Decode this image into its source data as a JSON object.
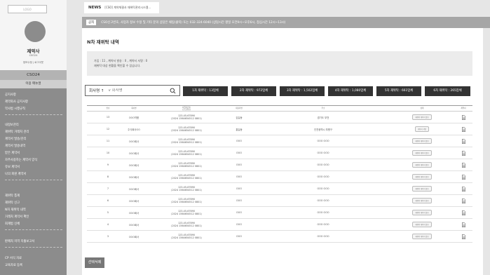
{
  "sidebar": {
    "logo": "LOGO",
    "pharmacy_name": "제약사",
    "pharmacy_code": "CSO24",
    "user_links": "정보수정 | 로그아웃",
    "code_label": "CSO24",
    "guide_label": "이용 매뉴얼",
    "groups": [
      [
        "공지사항",
        "제약회사 공지사항",
        "약사법 시행규칙"
      ],
      [
        "내정보관리",
        "재위탁 거래처 관리",
        "계약서 발송/관리",
        "계약서 발송내역",
        "받은 계약서",
        "자주사용하는 계약서 양식",
        "유보 계약서",
        "나의 회원 계약서"
      ],
      [
        "재위탁 통계",
        "재위탁 신고",
        "N차 재위탁 내역",
        "거래처 계약서 확인",
        "회계법 신체"
      ],
      [
        "판매처 지역 지출보고서"
      ],
      [
        "CP 서식 자료",
        "교육자료 등록"
      ]
    ]
  },
  "topbar": {
    "news_label": "NEWS",
    "news_text": "[CSO] 계약체결사 재위탁관리시스템..."
  },
  "notice": {
    "tag": "공지",
    "text": "CSO신고번호, 사업자 정보 수정 및 기타 문의 상담은 채팅(클릭) 또는 032-324-6040 (상담시간 평일 오전9시~오후6시, 점심시간 12시~13시)"
  },
  "main": {
    "title": "N차 재위탁 내역",
    "summary_line1": "가입 : 11 , 계약서 발송 : 0 , 계약서 서명 : 0",
    "summary_line2": "재위탁 대상 현황을 확인할 수 있습니다.",
    "search_select": "회사명 ↑",
    "search_placeholder": "v 회사명",
    "filters": [
      "1차 재위탁 : 13업체",
      "2차 재위탁 : 972업체",
      "3차 재위탁 : 1,502업체",
      "4차 재위탁 : 1,080업체",
      "5차 재위탁 : 661업체",
      "6차 재위탁 : 265업체"
    ],
    "bulk_delete": "선택삭제"
  },
  "table": {
    "headers": [
      "",
      "번호",
      "회사명",
      "사업자번호\n(신고번호)",
      "대표자명",
      "주소",
      "상태",
      "계약서"
    ],
    "rows": [
      {
        "no": "13",
        "company": "OOO약품",
        "biz": "123-45-67890",
        "reg": "(2024 1564654512 0801)",
        "ceo": "김길동",
        "addr": "경기도 부천",
        "status": "재위탁 계약서 발송"
      },
      {
        "no": "12",
        "company": "주식회사OO",
        "biz": "123-45-67890",
        "reg": "(2024 1564654512 0801)",
        "ceo": "홍길동",
        "addr": "인천광역시 부평구",
        "status": "계약서 서명"
      },
      {
        "no": "11",
        "company": "OOO회사",
        "biz": "123-45-67890",
        "reg": "(2024 1564654512 0801)",
        "ceo": "OOO",
        "addr": "OOO OOO",
        "status": "재위탁 계약서 발송"
      },
      {
        "no": "10",
        "company": "OOO회사",
        "biz": "123-45-67890",
        "reg": "(2024 1564654512 0801)",
        "ceo": "OOO",
        "addr": "OOO OOO",
        "status": "재위탁 계약서 발송"
      },
      {
        "no": "9",
        "company": "OOO회사",
        "biz": "123-45-67890",
        "reg": "(2024 1564654512 0801)",
        "ceo": "OOO",
        "addr": "OOO OOO",
        "status": "재위탁 계약서 발송"
      },
      {
        "no": "8",
        "company": "OOO회사",
        "biz": "123-45-67890",
        "reg": "(2024 1564654512 0801)",
        "ceo": "OOO",
        "addr": "OOO OOO",
        "status": "재위탁 계약서 발송"
      },
      {
        "no": "7",
        "company": "OOO회사",
        "biz": "123-45-67890",
        "reg": "(2024 1564654512 0801)",
        "ceo": "OOO",
        "addr": "OOO OOO",
        "status": "재위탁 계약서 발송"
      },
      {
        "no": "6",
        "company": "OOO회사",
        "biz": "123-45-67890",
        "reg": "(2024 1564654512 0801)",
        "ceo": "OOO",
        "addr": "OOO OOO",
        "status": "재위탁 계약서 발송"
      },
      {
        "no": "5",
        "company": "OOO회사",
        "biz": "123-45-67890",
        "reg": "(2024 1564654512 0801)",
        "ceo": "OOO",
        "addr": "OOO OOO",
        "status": "재위탁 계약서 발송"
      },
      {
        "no": "4",
        "company": "OOO회사",
        "biz": "123-45-67890",
        "reg": "(2024 1564654512 0801)",
        "ceo": "OOO",
        "addr": "OOO OOO",
        "status": "재위탁 계약서 발송"
      },
      {
        "no": "3",
        "company": "OOO회사",
        "biz": "123-45-67890",
        "reg": "(2024 1564654512 0801)",
        "ceo": "OOO",
        "addr": "OOO OOO",
        "status": "재위탁 계약서 발송"
      }
    ]
  }
}
